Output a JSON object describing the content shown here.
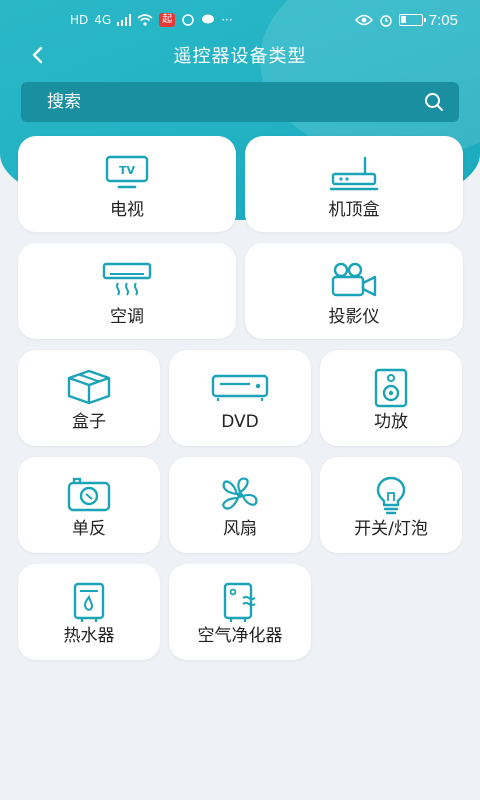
{
  "status_bar": {
    "left_indicators": [
      "HD",
      "4G",
      "signal",
      "wifi"
    ],
    "badge": "起",
    "time": "7:05"
  },
  "header": {
    "title": "遥控器设备类型",
    "back_icon": "chevron-left-icon"
  },
  "search": {
    "placeholder": "搜索",
    "icon": "search-icon"
  },
  "devices": [
    {
      "label": "电视",
      "icon": "tv-icon"
    },
    {
      "label": "机顶盒",
      "icon": "set-top-box-icon"
    },
    {
      "label": "空调",
      "icon": "air-conditioner-icon"
    },
    {
      "label": "投影仪",
      "icon": "projector-icon"
    },
    {
      "label": "盒子",
      "icon": "box-icon"
    },
    {
      "label": "DVD",
      "icon": "dvd-player-icon"
    },
    {
      "label": "功放",
      "icon": "speaker-icon"
    },
    {
      "label": "单反",
      "icon": "camera-icon"
    },
    {
      "label": "风扇",
      "icon": "fan-icon"
    },
    {
      "label": "开关/灯泡",
      "icon": "light-bulb-icon"
    },
    {
      "label": "热水器",
      "icon": "water-heater-icon"
    },
    {
      "label": "空气净化器",
      "icon": "air-purifier-icon"
    }
  ],
  "colors": {
    "header_bg": "#22b2c4",
    "search_bg": "#1a8fa0",
    "icon_color": "#1ba3b8",
    "page_bg": "#eef2f6",
    "card_bg": "#ffffff"
  }
}
